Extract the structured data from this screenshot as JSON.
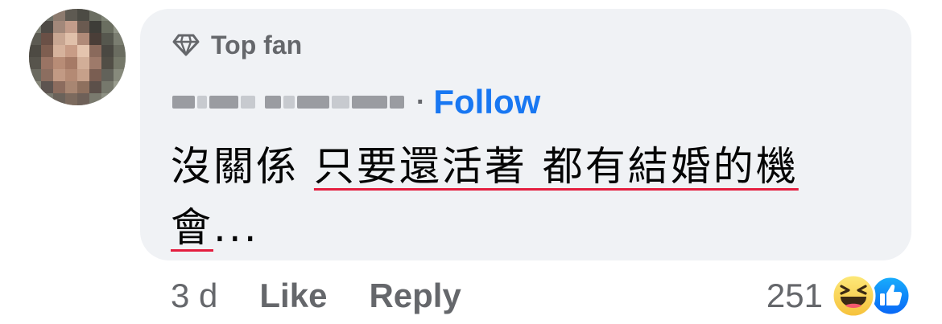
{
  "comment": {
    "badge": "Top fan",
    "follow_label": "Follow",
    "separator": "·",
    "text_part1": "沒關係 ",
    "text_part2": "只要還活著 都有結婚的機",
    "text_part3": "會",
    "text_part4": "...",
    "timestamp": "3 d",
    "like_label": "Like",
    "reply_label": "Reply",
    "reaction_count": "251"
  },
  "icons": {
    "badge": "diamond-icon",
    "reaction_1": "haha-emoji-icon",
    "reaction_2": "like-thumb-icon"
  },
  "colors": {
    "bubble_bg": "#f0f2f5",
    "link": "#1877f2",
    "muted": "#65676b",
    "spellcheck": "#e41e3f"
  }
}
